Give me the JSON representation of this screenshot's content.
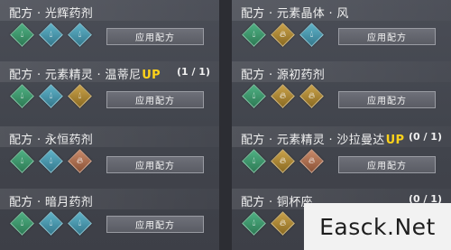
{
  "button_label": "应用配方",
  "colors": {
    "up_highlight": "#ffd21a",
    "gem_green": "#3f9a6c",
    "gem_blue": "#4a9ab0",
    "gem_gold": "#b08a3a",
    "gem_copper": "#b0714f"
  },
  "left": [
    {
      "title": "配方 · 光辉药剂",
      "up": "",
      "count": "",
      "icons": [
        "green-drop-icon",
        "blue-drop-icon",
        "blue-drop-icon"
      ]
    },
    {
      "title": "配方 · 元素精灵 · 温蒂尼",
      "up": "UP",
      "count": "(1 / 1)",
      "icons": [
        "green-drop-icon",
        "blue-drop-icon",
        "gold-drop-icon"
      ]
    },
    {
      "title": "配方 · 永恒药剂",
      "up": "",
      "count": "",
      "icons": [
        "green-drop-icon",
        "blue-drop-icon",
        "copper-flame-icon"
      ]
    },
    {
      "title": "配方 · 暗月药剂",
      "up": "",
      "count": "",
      "icons": [
        "green-drop-icon",
        "blue-drop-icon",
        "blue-drop-icon"
      ]
    }
  ],
  "right": [
    {
      "title": "配方 · 元素晶体 · 风",
      "up": "",
      "count": "",
      "icons": [
        "green-drop-icon",
        "gold-flame-icon",
        "blue-drop-icon"
      ]
    },
    {
      "title": "配方 · 源初药剂",
      "up": "",
      "count": "",
      "icons": [
        "green-drop-icon",
        "gold-flame-icon",
        "gold-flame-icon"
      ]
    },
    {
      "title": "配方 · 元素精灵 · 沙拉曼达",
      "up": "UP",
      "count": "(0 / 1)",
      "icons": [
        "green-drop-icon",
        "gold-flame-icon",
        "copper-flame-icon"
      ]
    },
    {
      "title": "配方 · 铜杯座",
      "up": "",
      "count": "(0 / 1)",
      "icons": [
        "green-drop-icon",
        "gold-flame-icon",
        ""
      ]
    }
  ],
  "watermark": "Easck.Net"
}
